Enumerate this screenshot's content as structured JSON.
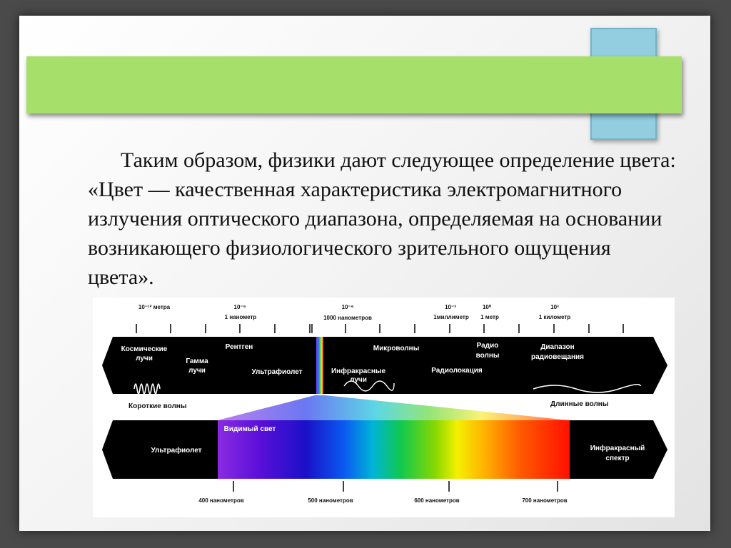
{
  "slide": {
    "paragraph": "Таким образом, физики дают следующее определение цвета: «Цвет — качественная характеристика электромагнитного излучения оптического диапазона, определяемая на основании возникающего физиологического зрительного ощущения цвета»."
  },
  "spectrum": {
    "top_scale": {
      "ticks": [
        "10⁻¹² метра",
        "10⁻⁹",
        "1 нанометр",
        "10⁻⁶",
        "1000 нанометров",
        "10⁻³",
        "1миллиметр",
        "10⁰",
        "1 метр",
        "10³",
        "1 километр"
      ]
    },
    "em_bands": {
      "cosmic": [
        "Космические",
        "лучи"
      ],
      "gamma": [
        "Гамма",
        "лучи"
      ],
      "xray": "Рентген",
      "uv": "Ультрафиолет",
      "infrared": [
        "Инфракрасные",
        "лучи"
      ],
      "microwaves": "Микроволны",
      "radar": "Радиолокация",
      "radio": [
        "Радио",
        "волны"
      ],
      "broadcast": [
        "Диапазон",
        "радиовещания"
      ]
    },
    "short_waves": "Короткие волны",
    "long_waves": "Длинные волны",
    "visible": {
      "title": "Видимый свет",
      "uv": "Ультрафиолет",
      "infrared": [
        "Инфракрасный",
        "спектр"
      ],
      "ticks": [
        "400 нанометров",
        "500 нанометров",
        "600 нанометров",
        "700 нанометров"
      ]
    },
    "colors": {
      "band": "#000000",
      "spectrum": [
        "#8a2be2",
        "#5a0fd8",
        "#1a10c8",
        "#0a5af0",
        "#00b4d8",
        "#10c850",
        "#8ad800",
        "#f4f000",
        "#ffb000",
        "#ff5a00",
        "#ff1000"
      ]
    }
  }
}
